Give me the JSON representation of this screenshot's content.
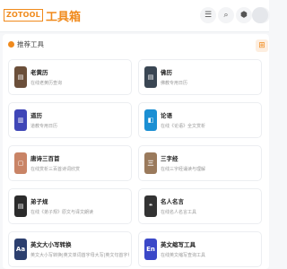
{
  "brand": {
    "logo_box": "ZOTOOL",
    "logo_text": "工具箱",
    "accent": "#f08a1c"
  },
  "header": {
    "icons": [
      {
        "name": "menu-icon",
        "glyph": "☰"
      },
      {
        "name": "search-icon",
        "glyph": "⌕"
      },
      {
        "name": "shield-icon",
        "glyph": "⬢"
      },
      {
        "name": "moon-icon",
        "glyph": "☽"
      }
    ]
  },
  "section": {
    "title": "推荐工具",
    "grid_glyph": "⊞"
  },
  "tools": [
    {
      "title": "老黄历",
      "desc": "在线老黄历查询",
      "icon_color": "#6b4f3a",
      "glyph": "▤"
    },
    {
      "title": "佛历",
      "desc": "佛教专用日历",
      "icon_color": "#3a4653",
      "glyph": "▤"
    },
    {
      "title": "道历",
      "desc": "道教专用日历",
      "icon_color": "#3f46b7",
      "glyph": "▥"
    },
    {
      "title": "论语",
      "desc": "在线《论语》全文赏析",
      "icon_color": "#1b8fd3",
      "glyph": "◧"
    },
    {
      "title": "唐诗三百首",
      "desc": "在线赏析三百首诗词欣赏",
      "icon_color": "#c98466",
      "glyph": "▢"
    },
    {
      "title": "三字经",
      "desc": "在线三字经诵读与理解",
      "icon_color": "#9a7a5c",
      "glyph": "三"
    },
    {
      "title": "弟子规",
      "desc": "在线《弟子规》原文与译文朗读",
      "icon_color": "#2b2b2b",
      "glyph": "▤"
    },
    {
      "title": "名人名言",
      "desc": "在线名人名言工具",
      "icon_color": "#333333",
      "glyph": "❝"
    },
    {
      "title": "英文大小写转换",
      "desc": "英文大小写转换|英文单词首字母大写|英文句首字母大写",
      "icon_color": "#2c3f6e",
      "glyph": "Aa"
    },
    {
      "title": "英文缩写工具",
      "desc": "在线英文缩写查询工具",
      "icon_color": "#3b48c8",
      "glyph": "En"
    }
  ]
}
